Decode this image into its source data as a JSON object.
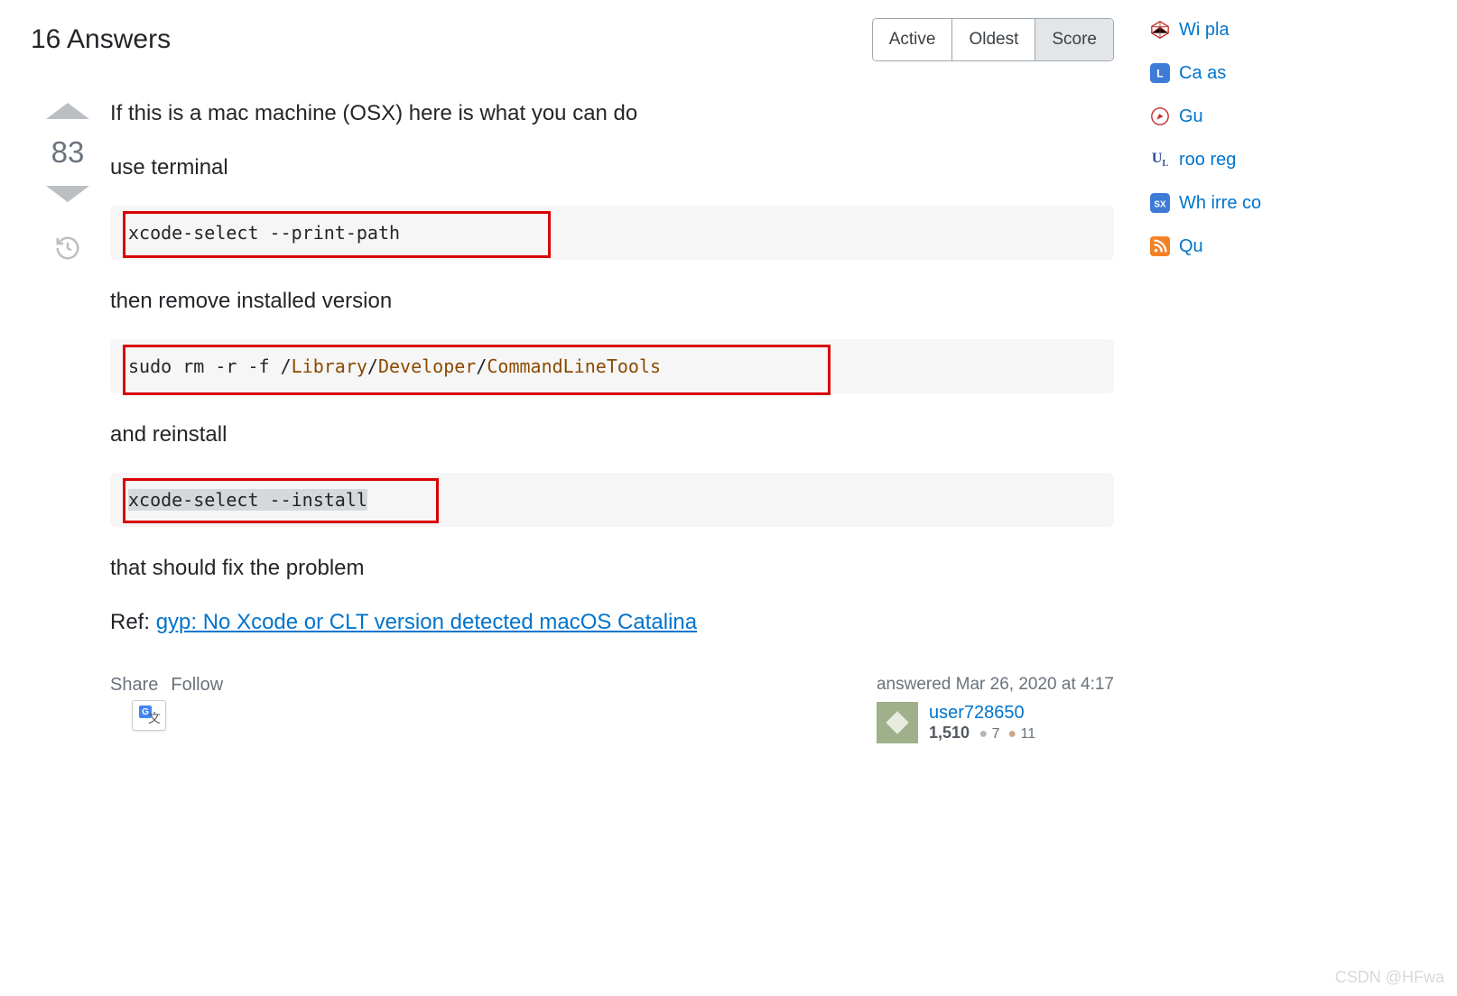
{
  "header": {
    "title": "16 Answers",
    "sort_tabs": [
      "Active",
      "Oldest",
      "Score"
    ],
    "active_tab": "Score"
  },
  "answer": {
    "vote_count": "83",
    "paragraphs": {
      "p1": "If this is a mac machine (OSX) here is what you can do",
      "p2": "use terminal",
      "p3": "then remove installed version",
      "p4": "and reinstall",
      "p5": "that should fix the problem",
      "ref_prefix": "Ref: ",
      "ref_link": "gyp: No Xcode or CLT version detected macOS Catalina"
    },
    "code": {
      "c1": "xcode-select --print-path",
      "c2_pre": "sudo rm -r -f /",
      "c2_lib": "Library",
      "c2_sep1": "/",
      "c2_dev": "Developer",
      "c2_sep2": "/",
      "c2_clt": "CommandLineTools",
      "c3": "xcode-select --install"
    },
    "actions": {
      "share": "Share",
      "follow": "Follow"
    },
    "user": {
      "answered": "answered Mar 26, 2020 at 4:17",
      "name": "user728650",
      "reputation": "1,510",
      "silver": "7",
      "bronze": "11"
    }
  },
  "sidebar": {
    "items": [
      {
        "icon": "d20-red",
        "text": "Wi pla"
      },
      {
        "icon": "badge-blue-l",
        "text": "Ca as"
      },
      {
        "icon": "compass-red",
        "text": "Gu"
      },
      {
        "icon": "ul-blue",
        "text": "roo reg"
      },
      {
        "icon": "badge-blue-sx",
        "text": "Wh irre co"
      },
      {
        "icon": "rss-orange",
        "text": "Qu"
      }
    ]
  },
  "watermark": "CSDN @HFwa"
}
